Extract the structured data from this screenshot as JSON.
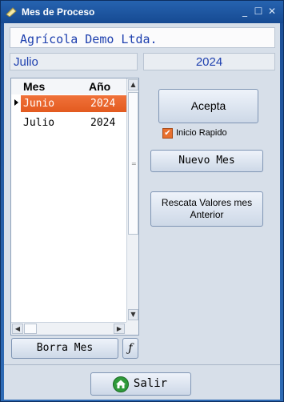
{
  "window": {
    "title": "Mes de Proceso",
    "minimize": "_",
    "maximize": "☐",
    "close": "✕"
  },
  "company": {
    "name": "Agrícola Demo Ltda."
  },
  "current": {
    "month": "Julio",
    "year": "2024"
  },
  "grid": {
    "headers": {
      "month": "Mes",
      "year": "Año"
    },
    "rows": [
      {
        "month": "Junio",
        "year": "2024",
        "selected": true
      },
      {
        "month": "Julio",
        "year": "2024",
        "selected": false
      }
    ]
  },
  "buttons": {
    "acepta": "Acepta",
    "nuevo_mes": "Nuevo Mes",
    "rescata": "Rescata Valores mes Anterior",
    "borra_mes": "Borra Mes",
    "function": "ƒ",
    "salir": "Salir"
  },
  "inicio_rapido": {
    "label": "Inicio Rapido",
    "checked": true
  },
  "colors": {
    "accent": "#e8702e",
    "text_blue": "#1d3fae",
    "title_bar": "#164a92"
  },
  "icons": [
    "app-icon",
    "check-icon",
    "home-icon"
  ]
}
